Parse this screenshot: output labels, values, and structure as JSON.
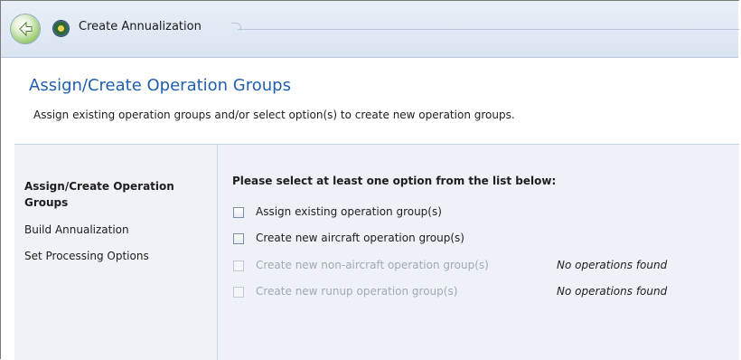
{
  "window": {
    "title": "Create Annualization",
    "back_icon": "back-arrow-icon",
    "app_icon": "app-globe-icon"
  },
  "header": {
    "title": "Assign/Create Operation Groups",
    "subtitle": "Assign existing operation groups and/or select option(s) to create new operation groups."
  },
  "nav": {
    "items": [
      {
        "label": "Assign/Create Operation Groups",
        "active": true
      },
      {
        "label": "Build Annualization",
        "active": false
      },
      {
        "label": "Set Processing Options",
        "active": false
      }
    ]
  },
  "main": {
    "instruction": "Please select at least one option from the list below:",
    "options": [
      {
        "label": "Assign existing operation group(s)",
        "enabled": true,
        "checked": false,
        "note": ""
      },
      {
        "label": "Create new aircraft operation group(s)",
        "enabled": true,
        "checked": false,
        "note": ""
      },
      {
        "label": "Create new non-aircraft operation group(s)",
        "enabled": false,
        "checked": false,
        "note": "No operations found"
      },
      {
        "label": "Create new runup operation group(s)",
        "enabled": false,
        "checked": false,
        "note": "No operations found"
      }
    ]
  },
  "colors": {
    "title_blue": "#1f5fae",
    "nav_bg": "#f0f2f7",
    "main_bg": "#eef1f7",
    "disabled_text": "#a4a9b1"
  }
}
